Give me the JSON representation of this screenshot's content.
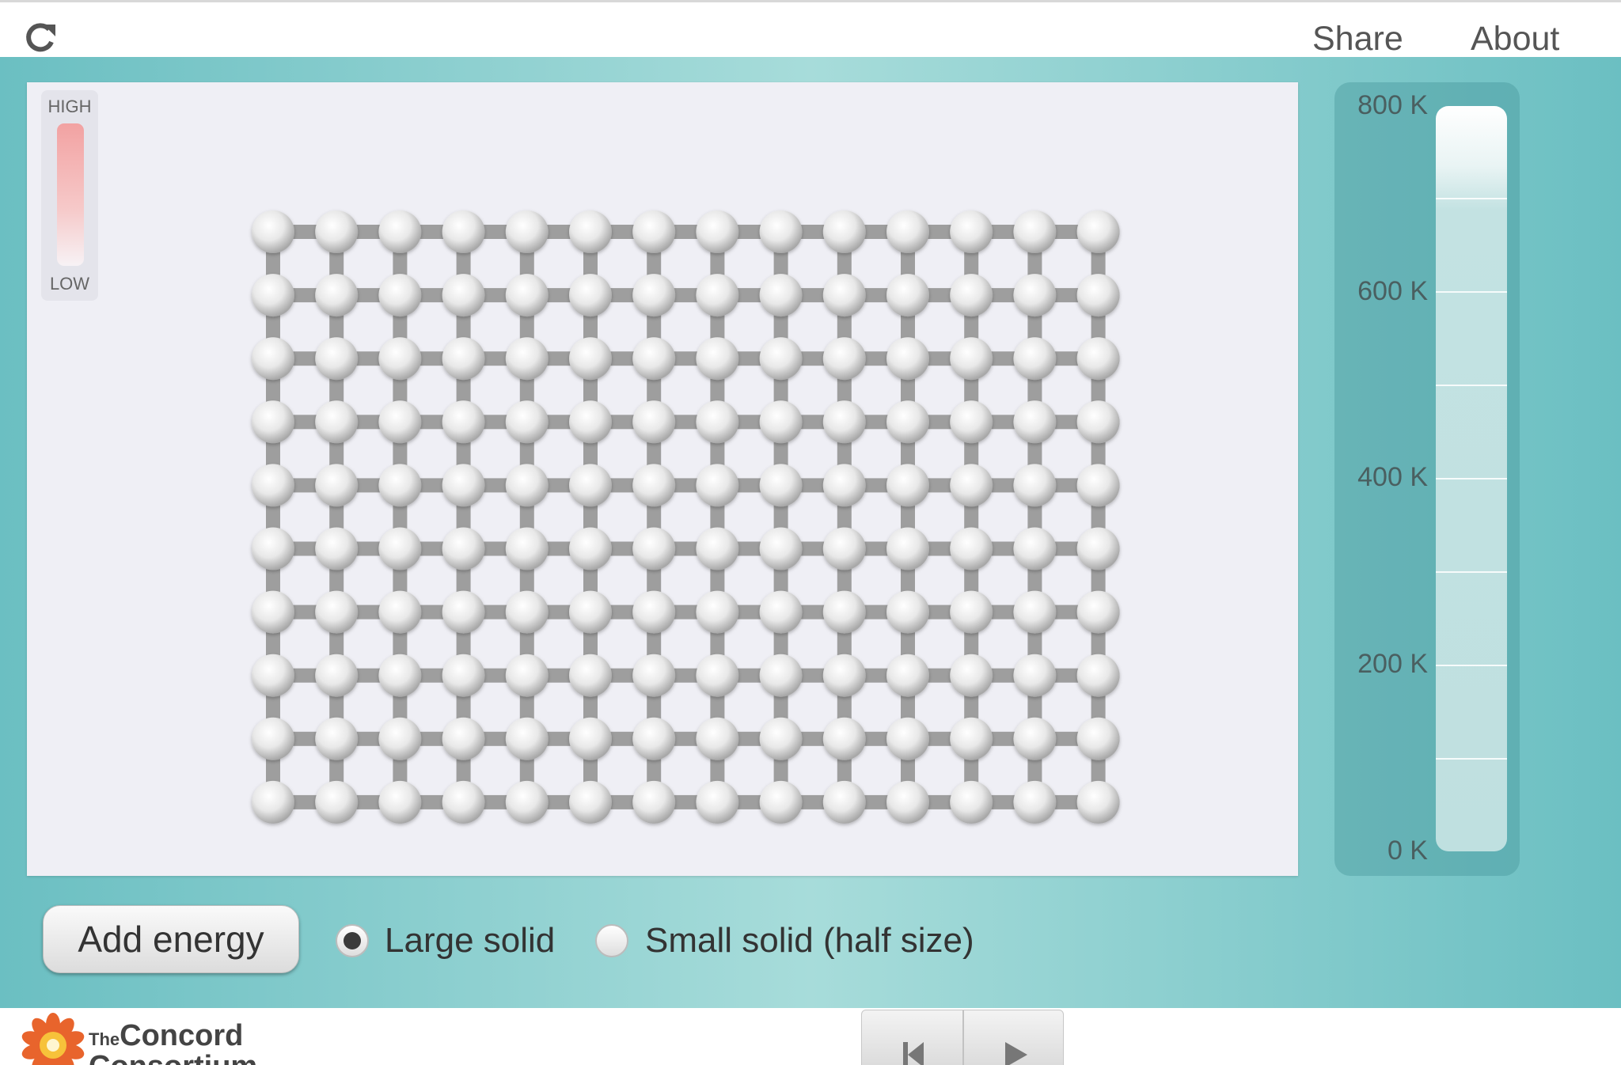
{
  "topbar": {
    "reload_icon": "reload-icon",
    "share_label": "Share",
    "about_label": "About"
  },
  "key": {
    "high_label": "HIGH",
    "low_label": "LOW"
  },
  "lattice": {
    "columns": 14,
    "rows": 10,
    "atom_color": "#e8e8e8",
    "bond_color": "#9e9e9e"
  },
  "thermometer": {
    "labels": [
      "800 K",
      "600 K",
      "400 K",
      "200 K",
      "0 K"
    ],
    "max_K": 800,
    "fill_level_K": 800
  },
  "controls": {
    "add_energy_label": "Add energy",
    "radio_options": [
      {
        "label": "Large solid",
        "selected": true
      },
      {
        "label": "Small solid (half size)",
        "selected": false
      }
    ]
  },
  "footer": {
    "logo_small": "The",
    "logo_line1": "Concord",
    "logo_line2": "Consortium",
    "playback": [
      "reset-icon",
      "play-icon"
    ]
  },
  "colors": {
    "background_teal": "#6bbfc2",
    "sim_bg": "#efeff5"
  }
}
